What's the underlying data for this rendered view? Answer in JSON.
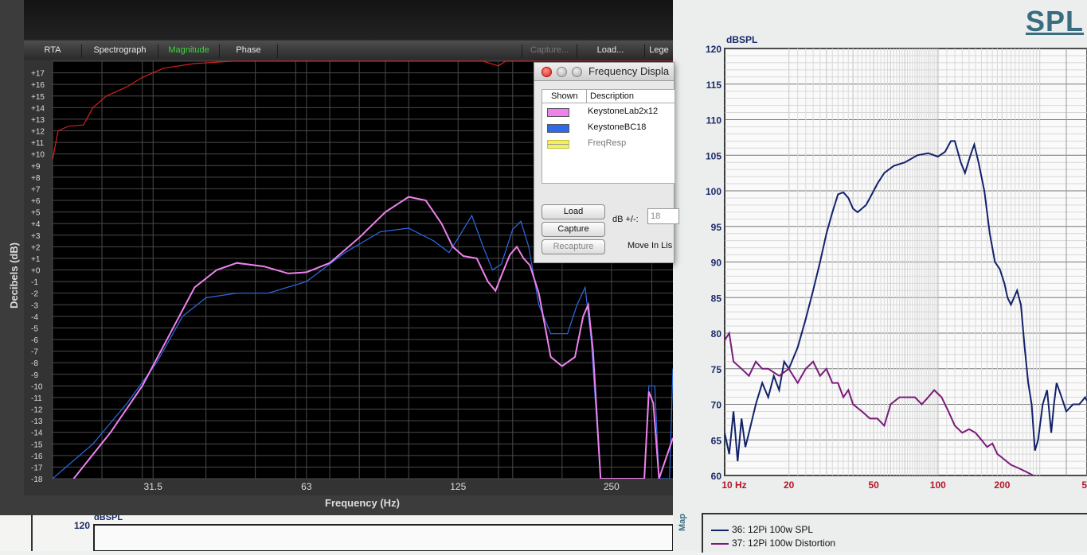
{
  "app": {
    "tabs": [
      {
        "label": "RTA",
        "state": "normal"
      },
      {
        "label": "Spectrograph",
        "state": "normal"
      },
      {
        "label": "Magnitude",
        "state": "active"
      },
      {
        "label": "Phase",
        "state": "normal"
      },
      {
        "label": "Capture...",
        "state": "dim"
      },
      {
        "label": "Load...",
        "state": "normal"
      },
      {
        "label": "Lege",
        "state": "normal"
      }
    ],
    "ylabel": "Decibels (dB)",
    "xlabel": "Frequency (Hz)",
    "colors": {
      "background": "#000000",
      "grid": "#3a3a3a",
      "axis_text": "#dddddd"
    }
  },
  "dialog": {
    "title": "Frequency Displa",
    "col_shown": "Shown",
    "col_description": "Description",
    "rows": [
      {
        "name": "KeystoneLab2x12",
        "color": "#ee82ee",
        "muted": false
      },
      {
        "name": "KeystoneBC18",
        "color": "#2f6be8",
        "muted": false
      },
      {
        "name": "FreqResp",
        "color": "#f0f060",
        "muted": true
      }
    ],
    "load_label": "Load",
    "capture_label": "Capture",
    "recapture_label": "Recapture",
    "db_label": "dB +/-:",
    "db_value": "18",
    "move_label": "Move In Lis"
  },
  "spl": {
    "title": "SPL",
    "legend": [
      {
        "label": "36: 12Pi 100w SPL",
        "color": "#12226a"
      },
      {
        "label": "37: 12Pi 100w Distortion",
        "color": "#7a1a7a"
      }
    ],
    "side_label": "Map",
    "bottom_y_label": "120",
    "bottom_unit": "dBSPL"
  },
  "chart_data": [
    {
      "type": "line",
      "title": "",
      "xlabel": "Frequency (Hz)",
      "ylabel": "Decibels (dB)",
      "xscale": "log",
      "xlim": [
        20,
        330
      ],
      "ylim": [
        -18,
        18
      ],
      "x_ticks": [
        "31.5",
        "63",
        "125",
        "250"
      ],
      "y_ticks": [
        "+17",
        "+16",
        "+15",
        "+14",
        "+13",
        "+12",
        "+11",
        "+10",
        "+9",
        "+8",
        "+7",
        "+6",
        "+5",
        "+4",
        "+3",
        "+2",
        "+1",
        "+0",
        "-1",
        "-2",
        "-3",
        "-4",
        "-5",
        "-6",
        "-7",
        "-8",
        "-9",
        "-10",
        "-11",
        "-12",
        "-13",
        "-14",
        "-15",
        "-16",
        "-17",
        "-18"
      ],
      "grid": true,
      "series": [
        {
          "name": "FreqResp",
          "color": "#d42020",
          "points": [
            [
              20,
              9.5
            ],
            [
              20.5,
              12
            ],
            [
              21.5,
              12.4
            ],
            [
              23,
              12.5
            ],
            [
              24,
              14
            ],
            [
              25.5,
              15
            ],
            [
              28,
              15.8
            ],
            [
              30,
              16.6
            ],
            [
              33,
              17.4
            ],
            [
              38,
              17.8
            ],
            [
              45,
              18
            ],
            [
              63,
              18
            ],
            [
              100,
              18
            ],
            [
              140,
              18
            ],
            [
              150,
              17.6
            ],
            [
              155,
              18
            ],
            [
              200,
              18
            ],
            [
              330,
              18
            ]
          ]
        },
        {
          "name": "KeystoneBC18",
          "color": "#2f6be8",
          "points": [
            [
              20,
              -18
            ],
            [
              24,
              -15
            ],
            [
              28,
              -11.5
            ],
            [
              32,
              -8
            ],
            [
              36,
              -4
            ],
            [
              40,
              -2.4
            ],
            [
              46,
              -2
            ],
            [
              53,
              -2
            ],
            [
              63,
              -1
            ],
            [
              75,
              1.5
            ],
            [
              88,
              3.3
            ],
            [
              100,
              3.6
            ],
            [
              112,
              2.5
            ],
            [
              120,
              1.5
            ],
            [
              126,
              3
            ],
            [
              133,
              4.7
            ],
            [
              140,
              2
            ],
            [
              146,
              0
            ],
            [
              152,
              0.5
            ],
            [
              160,
              3.5
            ],
            [
              166,
              4.2
            ],
            [
              172,
              2
            ],
            [
              180,
              -3
            ],
            [
              190,
              -5.5
            ],
            [
              205,
              -5.5
            ],
            [
              214,
              -3
            ],
            [
              222,
              -1.5
            ],
            [
              228,
              -6
            ],
            [
              238,
              -18
            ],
            [
              290,
              -18
            ],
            [
              296,
              -10
            ],
            [
              304,
              -10
            ],
            [
              310,
              -18
            ],
            [
              325,
              -18
            ],
            [
              330,
              -8.5
            ]
          ]
        },
        {
          "name": "KeystoneLab2x12",
          "color": "#ee82ee",
          "points": [
            [
              22,
              -18
            ],
            [
              26,
              -14
            ],
            [
              30,
              -10
            ],
            [
              34,
              -5.5
            ],
            [
              38,
              -1.5
            ],
            [
              42,
              0
            ],
            [
              46,
              0.6
            ],
            [
              52,
              0.3
            ],
            [
              58,
              -0.3
            ],
            [
              63,
              -0.2
            ],
            [
              70,
              0.6
            ],
            [
              80,
              2.8
            ],
            [
              90,
              5
            ],
            [
              100,
              6.3
            ],
            [
              108,
              6
            ],
            [
              116,
              4
            ],
            [
              122,
              2
            ],
            [
              128,
              1.2
            ],
            [
              136,
              1
            ],
            [
              143,
              -1
            ],
            [
              148,
              -1.8
            ],
            [
              152,
              -0.5
            ],
            [
              158,
              1.3
            ],
            [
              163,
              2
            ],
            [
              168,
              1
            ],
            [
              173,
              0.4
            ],
            [
              180,
              -2
            ],
            [
              190,
              -7.5
            ],
            [
              200,
              -8.3
            ],
            [
              212,
              -7.5
            ],
            [
              220,
              -4
            ],
            [
              225,
              -3
            ],
            [
              230,
              -7
            ],
            [
              238,
              -18
            ],
            [
              290,
              -18
            ],
            [
              296,
              -10.5
            ],
            [
              302,
              -11.5
            ],
            [
              310,
              -18
            ],
            [
              330,
              -14.5
            ]
          ]
        }
      ]
    },
    {
      "type": "line",
      "title": "SPL",
      "xlabel": "",
      "ylabel": "dBSPL",
      "xscale": "log",
      "xlim": [
        10,
        500
      ],
      "ylim": [
        60,
        120
      ],
      "x_ticks": [
        "10 Hz",
        "20",
        "50",
        "100",
        "200",
        "5"
      ],
      "y_ticks": [
        "120",
        "115",
        "110",
        "105",
        "100",
        "95",
        "90",
        "85",
        "80",
        "75",
        "70",
        "65",
        "60"
      ],
      "grid": true,
      "series": [
        {
          "name": "36: 12Pi 100w SPL",
          "color": "#12226a",
          "points": [
            [
              10,
              66
            ],
            [
              10.5,
              63
            ],
            [
              11,
              69
            ],
            [
              11.5,
              62
            ],
            [
              12,
              68
            ],
            [
              12.5,
              64
            ],
            [
              13,
              66
            ],
            [
              14,
              70
            ],
            [
              15,
              73
            ],
            [
              16,
              71
            ],
            [
              17,
              74
            ],
            [
              18,
              72
            ],
            [
              19,
              76
            ],
            [
              20,
              75
            ],
            [
              22,
              78
            ],
            [
              24,
              82
            ],
            [
              26,
              86
            ],
            [
              28,
              90
            ],
            [
              30,
              94
            ],
            [
              32,
              97
            ],
            [
              34,
              99.5
            ],
            [
              36,
              99.8
            ],
            [
              38,
              99
            ],
            [
              40,
              97.5
            ],
            [
              42,
              97
            ],
            [
              44,
              97.5
            ],
            [
              46,
              98
            ],
            [
              48,
              99
            ],
            [
              52,
              101
            ],
            [
              56,
              102.5
            ],
            [
              62,
              103.5
            ],
            [
              70,
              104
            ],
            [
              80,
              105
            ],
            [
              90,
              105.3
            ],
            [
              100,
              104.8
            ],
            [
              108,
              105.5
            ],
            [
              115,
              107
            ],
            [
              120,
              107
            ],
            [
              128,
              104
            ],
            [
              134,
              102.5
            ],
            [
              142,
              105
            ],
            [
              148,
              106.5
            ],
            [
              155,
              104
            ],
            [
              165,
              100
            ],
            [
              175,
              94
            ],
            [
              185,
              90
            ],
            [
              195,
              89
            ],
            [
              205,
              87
            ],
            [
              212,
              85
            ],
            [
              220,
              84
            ],
            [
              235,
              86
            ],
            [
              245,
              84
            ],
            [
              255,
              78
            ],
            [
              265,
              73
            ],
            [
              275,
              70
            ],
            [
              285,
              63.5
            ],
            [
              295,
              65
            ],
            [
              310,
              70
            ],
            [
              325,
              72
            ],
            [
              340,
              66
            ],
            [
              350,
              70
            ],
            [
              360,
              73
            ],
            [
              380,
              71
            ],
            [
              400,
              69
            ],
            [
              430,
              70
            ],
            [
              460,
              70
            ],
            [
              490,
              71
            ],
            [
              500,
              70.5
            ]
          ]
        },
        {
          "name": "37: 12Pi 100w Distortion",
          "color": "#7a1a7a",
          "points": [
            [
              10,
              79
            ],
            [
              10.5,
              80
            ],
            [
              11,
              76
            ],
            [
              12,
              75
            ],
            [
              13,
              74
            ],
            [
              14,
              76
            ],
            [
              15,
              75
            ],
            [
              16,
              75
            ],
            [
              18,
              74
            ],
            [
              20,
              75
            ],
            [
              22,
              73
            ],
            [
              24,
              75
            ],
            [
              26,
              76
            ],
            [
              28,
              74
            ],
            [
              30,
              75
            ],
            [
              32,
              73
            ],
            [
              34,
              73
            ],
            [
              36,
              71
            ],
            [
              38,
              72
            ],
            [
              40,
              70
            ],
            [
              44,
              69
            ],
            [
              48,
              68
            ],
            [
              52,
              68
            ],
            [
              56,
              67
            ],
            [
              60,
              70
            ],
            [
              66,
              71
            ],
            [
              72,
              71
            ],
            [
              78,
              71
            ],
            [
              84,
              70
            ],
            [
              90,
              71
            ],
            [
              96,
              72
            ],
            [
              104,
              71
            ],
            [
              112,
              69
            ],
            [
              120,
              67
            ],
            [
              130,
              66
            ],
            [
              140,
              66.5
            ],
            [
              150,
              66
            ],
            [
              160,
              65
            ],
            [
              170,
              64
            ],
            [
              180,
              64.5
            ],
            [
              190,
              63
            ],
            [
              200,
              62.5
            ],
            [
              220,
              61.5
            ],
            [
              240,
              61
            ],
            [
              260,
              60.5
            ],
            [
              280,
              60
            ]
          ]
        }
      ]
    }
  ]
}
